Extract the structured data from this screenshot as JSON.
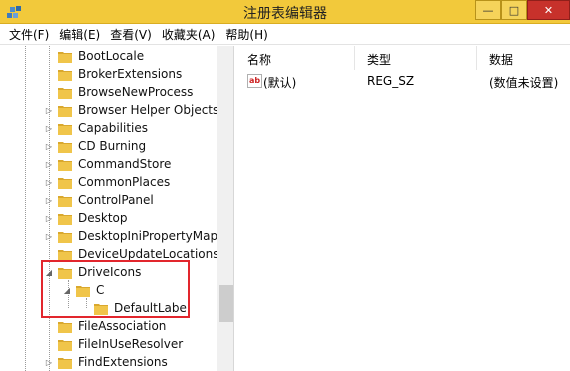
{
  "window": {
    "title": "注册表编辑器"
  },
  "controls": {
    "minimize": "—",
    "maximize": "□",
    "close": "✕"
  },
  "menu": [
    "文件(F)",
    "编辑(E)",
    "查看(V)",
    "收藏夹(A)",
    "帮助(H)"
  ],
  "tree": {
    "items": [
      {
        "label": "BootLocale",
        "expander": ""
      },
      {
        "label": "BrokerExtensions",
        "expander": ""
      },
      {
        "label": "BrowseNewProcess",
        "expander": ""
      },
      {
        "label": "Browser Helper Objects",
        "expander": "▷"
      },
      {
        "label": "Capabilities",
        "expander": "▷"
      },
      {
        "label": "CD Burning",
        "expander": "▷"
      },
      {
        "label": "CommandStore",
        "expander": "▷"
      },
      {
        "label": "CommonPlaces",
        "expander": "▷"
      },
      {
        "label": "ControlPanel",
        "expander": "▷"
      },
      {
        "label": "Desktop",
        "expander": "▷"
      },
      {
        "label": "DesktopIniPropertyMap",
        "expander": "▷"
      },
      {
        "label": "DeviceUpdateLocations",
        "expander": ""
      },
      {
        "label": "DriveIcons",
        "expander": "◢"
      },
      {
        "label": "C",
        "expander": "◢"
      },
      {
        "label": "DefaultLabel",
        "expander": ""
      },
      {
        "label": "FileAssociation",
        "expander": ""
      },
      {
        "label": "FileInUseResolver",
        "expander": ""
      },
      {
        "label": "FindExtensions",
        "expander": "▷"
      }
    ]
  },
  "list": {
    "headers": {
      "name": "名称",
      "type": "类型",
      "data": "数据"
    },
    "rows": [
      {
        "icon": "ab",
        "name": "(默认)",
        "type": "REG_SZ",
        "data": "(数值未设置)"
      }
    ]
  },
  "colors": {
    "title_bar": "#f2c93b",
    "close": "#c7312b",
    "highlight": "#e2262d",
    "folder": "#f0c54a"
  }
}
